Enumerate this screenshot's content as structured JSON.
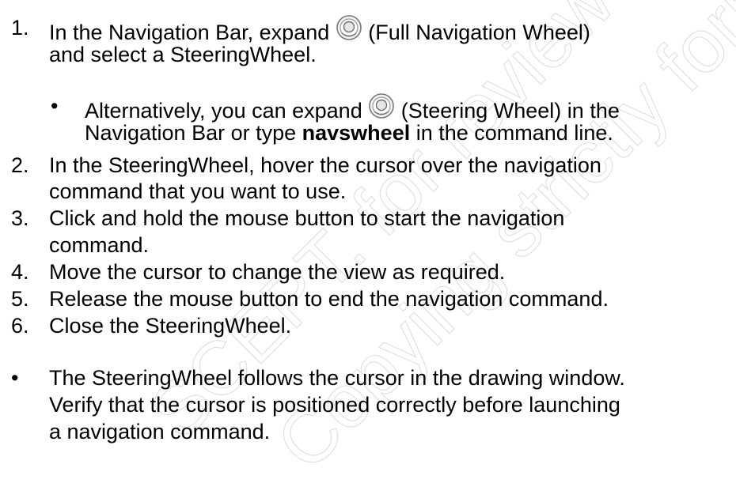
{
  "watermark": {
    "line1": "SCEPT. for review only",
    "line2": "Copying strictly forbidden"
  },
  "icons": {
    "full_wheel": "full-navigation-wheel-icon",
    "steering_wheel": "steering-wheel-icon"
  },
  "steps": [
    {
      "number": "1.",
      "line1_before": "In the Navigation Bar, expand ",
      "line1_after": " (Full Navigation Wheel)",
      "line2": "and select a SteeringWheel."
    },
    {
      "number": "2.",
      "line1": "In the SteeringWheel, hover the cursor over the navigation",
      "line2": "command that you want to use."
    },
    {
      "number": "3.",
      "line1": "Click and hold the mouse button to start the navigation",
      "line2": "command."
    },
    {
      "number": "4.",
      "line1": "Move the cursor to change the view as required."
    },
    {
      "number": "5.",
      "line1": "Release the mouse button to end the navigation command."
    },
    {
      "number": "6.",
      "line1": "Close the SteeringWheel."
    }
  ],
  "sub_bullet": {
    "bullet": "•",
    "line1_before": "Alternatively, you can expand ",
    "line1_after": " (Steering Wheel) in the",
    "line2_before": "Navigation Bar or type ",
    "line2_bold": "navswheel",
    "line2_after": " in the command line."
  },
  "note": {
    "bullet": "•",
    "line1": "The SteeringWheel follows the cursor in the drawing window.",
    "line2": "Verify that the cursor is positioned correctly before launching",
    "line3": "a navigation command."
  }
}
